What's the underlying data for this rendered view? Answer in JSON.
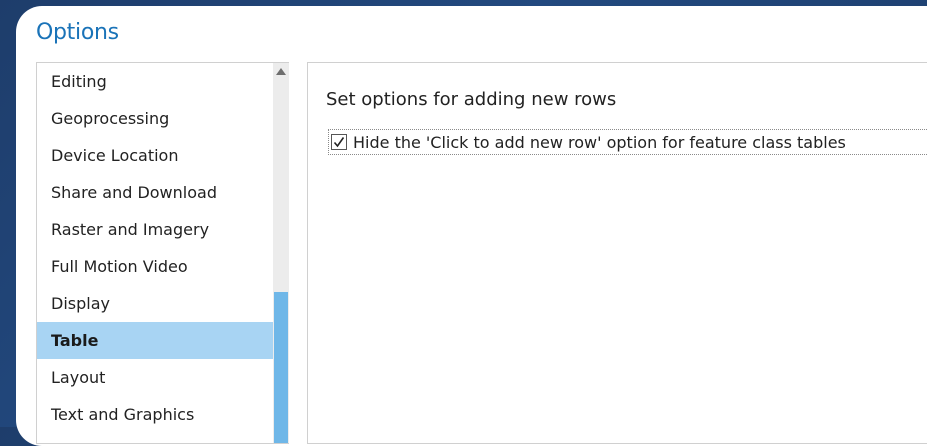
{
  "dialog": {
    "title": "Options"
  },
  "sidebar": {
    "items": [
      {
        "label": "Editing"
      },
      {
        "label": "Geoprocessing"
      },
      {
        "label": "Device Location"
      },
      {
        "label": "Share and Download"
      },
      {
        "label": "Raster and Imagery"
      },
      {
        "label": "Full Motion Video"
      },
      {
        "label": "Display"
      },
      {
        "label": "Table"
      },
      {
        "label": "Layout"
      },
      {
        "label": "Text and Graphics"
      }
    ],
    "selected_item": "Table"
  },
  "content": {
    "heading": "Set options for adding new rows",
    "options": [
      {
        "label": "Hide the 'Click to add new row' option for feature class tables",
        "checked": true
      }
    ]
  },
  "colors": {
    "title": "#1a73b8",
    "selection": "#a8d4f3",
    "scroll_thumb": "#6fb7e8",
    "background": "#1e3d6b"
  },
  "icons": {
    "scroll_up": "triangle-up-icon",
    "checkmark": "checkmark-icon"
  }
}
